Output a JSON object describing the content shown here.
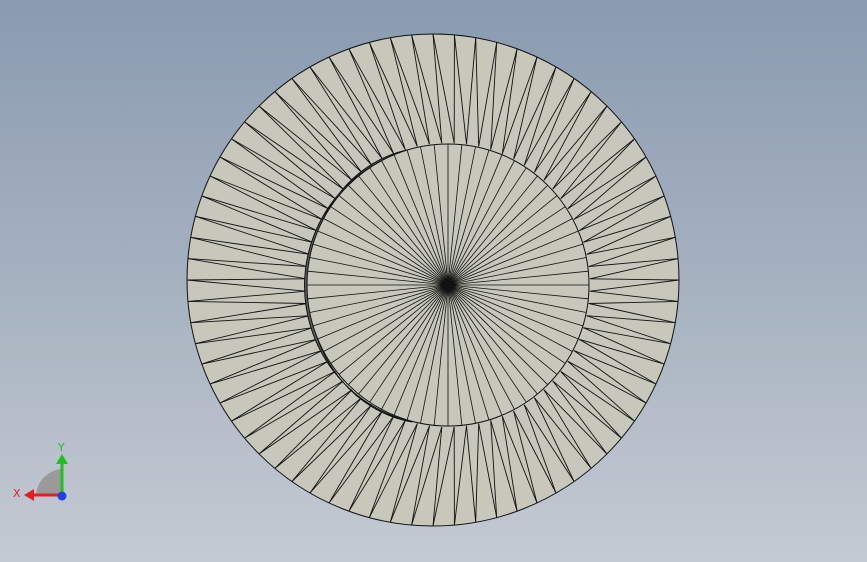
{
  "viewport": {
    "background_top": "#8a9bb0",
    "background_bottom": "#c4cad3"
  },
  "model": {
    "face_color": "#c7c7bc",
    "edge_color": "#111111",
    "shadow_color": "#5f5f58",
    "outer_segments": 72,
    "inner_segments": 64
  },
  "triad": {
    "x_label": "X",
    "y_label": "Y",
    "x_color": "#e02020",
    "y_color": "#20c020",
    "z_color": "#2040e0"
  }
}
